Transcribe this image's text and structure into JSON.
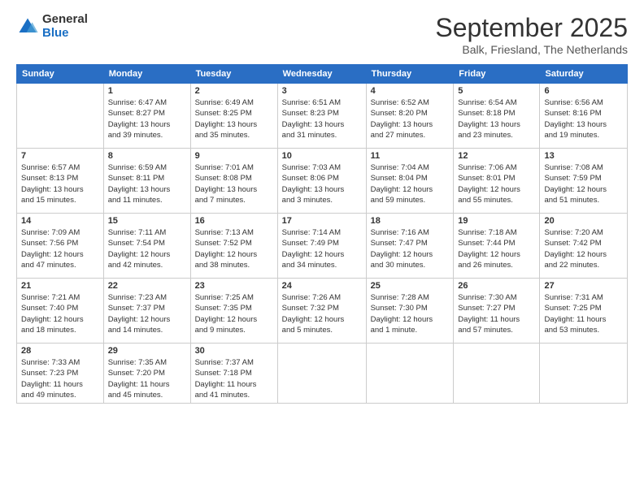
{
  "logo": {
    "general": "General",
    "blue": "Blue"
  },
  "title": "September 2025",
  "location": "Balk, Friesland, The Netherlands",
  "days_of_week": [
    "Sunday",
    "Monday",
    "Tuesday",
    "Wednesday",
    "Thursday",
    "Friday",
    "Saturday"
  ],
  "weeks": [
    [
      {
        "num": "",
        "info": ""
      },
      {
        "num": "1",
        "info": "Sunrise: 6:47 AM\nSunset: 8:27 PM\nDaylight: 13 hours\nand 39 minutes."
      },
      {
        "num": "2",
        "info": "Sunrise: 6:49 AM\nSunset: 8:25 PM\nDaylight: 13 hours\nand 35 minutes."
      },
      {
        "num": "3",
        "info": "Sunrise: 6:51 AM\nSunset: 8:23 PM\nDaylight: 13 hours\nand 31 minutes."
      },
      {
        "num": "4",
        "info": "Sunrise: 6:52 AM\nSunset: 8:20 PM\nDaylight: 13 hours\nand 27 minutes."
      },
      {
        "num": "5",
        "info": "Sunrise: 6:54 AM\nSunset: 8:18 PM\nDaylight: 13 hours\nand 23 minutes."
      },
      {
        "num": "6",
        "info": "Sunrise: 6:56 AM\nSunset: 8:16 PM\nDaylight: 13 hours\nand 19 minutes."
      }
    ],
    [
      {
        "num": "7",
        "info": "Sunrise: 6:57 AM\nSunset: 8:13 PM\nDaylight: 13 hours\nand 15 minutes."
      },
      {
        "num": "8",
        "info": "Sunrise: 6:59 AM\nSunset: 8:11 PM\nDaylight: 13 hours\nand 11 minutes."
      },
      {
        "num": "9",
        "info": "Sunrise: 7:01 AM\nSunset: 8:08 PM\nDaylight: 13 hours\nand 7 minutes."
      },
      {
        "num": "10",
        "info": "Sunrise: 7:03 AM\nSunset: 8:06 PM\nDaylight: 13 hours\nand 3 minutes."
      },
      {
        "num": "11",
        "info": "Sunrise: 7:04 AM\nSunset: 8:04 PM\nDaylight: 12 hours\nand 59 minutes."
      },
      {
        "num": "12",
        "info": "Sunrise: 7:06 AM\nSunset: 8:01 PM\nDaylight: 12 hours\nand 55 minutes."
      },
      {
        "num": "13",
        "info": "Sunrise: 7:08 AM\nSunset: 7:59 PM\nDaylight: 12 hours\nand 51 minutes."
      }
    ],
    [
      {
        "num": "14",
        "info": "Sunrise: 7:09 AM\nSunset: 7:56 PM\nDaylight: 12 hours\nand 47 minutes."
      },
      {
        "num": "15",
        "info": "Sunrise: 7:11 AM\nSunset: 7:54 PM\nDaylight: 12 hours\nand 42 minutes."
      },
      {
        "num": "16",
        "info": "Sunrise: 7:13 AM\nSunset: 7:52 PM\nDaylight: 12 hours\nand 38 minutes."
      },
      {
        "num": "17",
        "info": "Sunrise: 7:14 AM\nSunset: 7:49 PM\nDaylight: 12 hours\nand 34 minutes."
      },
      {
        "num": "18",
        "info": "Sunrise: 7:16 AM\nSunset: 7:47 PM\nDaylight: 12 hours\nand 30 minutes."
      },
      {
        "num": "19",
        "info": "Sunrise: 7:18 AM\nSunset: 7:44 PM\nDaylight: 12 hours\nand 26 minutes."
      },
      {
        "num": "20",
        "info": "Sunrise: 7:20 AM\nSunset: 7:42 PM\nDaylight: 12 hours\nand 22 minutes."
      }
    ],
    [
      {
        "num": "21",
        "info": "Sunrise: 7:21 AM\nSunset: 7:40 PM\nDaylight: 12 hours\nand 18 minutes."
      },
      {
        "num": "22",
        "info": "Sunrise: 7:23 AM\nSunset: 7:37 PM\nDaylight: 12 hours\nand 14 minutes."
      },
      {
        "num": "23",
        "info": "Sunrise: 7:25 AM\nSunset: 7:35 PM\nDaylight: 12 hours\nand 9 minutes."
      },
      {
        "num": "24",
        "info": "Sunrise: 7:26 AM\nSunset: 7:32 PM\nDaylight: 12 hours\nand 5 minutes."
      },
      {
        "num": "25",
        "info": "Sunrise: 7:28 AM\nSunset: 7:30 PM\nDaylight: 12 hours\nand 1 minute."
      },
      {
        "num": "26",
        "info": "Sunrise: 7:30 AM\nSunset: 7:27 PM\nDaylight: 11 hours\nand 57 minutes."
      },
      {
        "num": "27",
        "info": "Sunrise: 7:31 AM\nSunset: 7:25 PM\nDaylight: 11 hours\nand 53 minutes."
      }
    ],
    [
      {
        "num": "28",
        "info": "Sunrise: 7:33 AM\nSunset: 7:23 PM\nDaylight: 11 hours\nand 49 minutes."
      },
      {
        "num": "29",
        "info": "Sunrise: 7:35 AM\nSunset: 7:20 PM\nDaylight: 11 hours\nand 45 minutes."
      },
      {
        "num": "30",
        "info": "Sunrise: 7:37 AM\nSunset: 7:18 PM\nDaylight: 11 hours\nand 41 minutes."
      },
      {
        "num": "",
        "info": ""
      },
      {
        "num": "",
        "info": ""
      },
      {
        "num": "",
        "info": ""
      },
      {
        "num": "",
        "info": ""
      }
    ]
  ]
}
